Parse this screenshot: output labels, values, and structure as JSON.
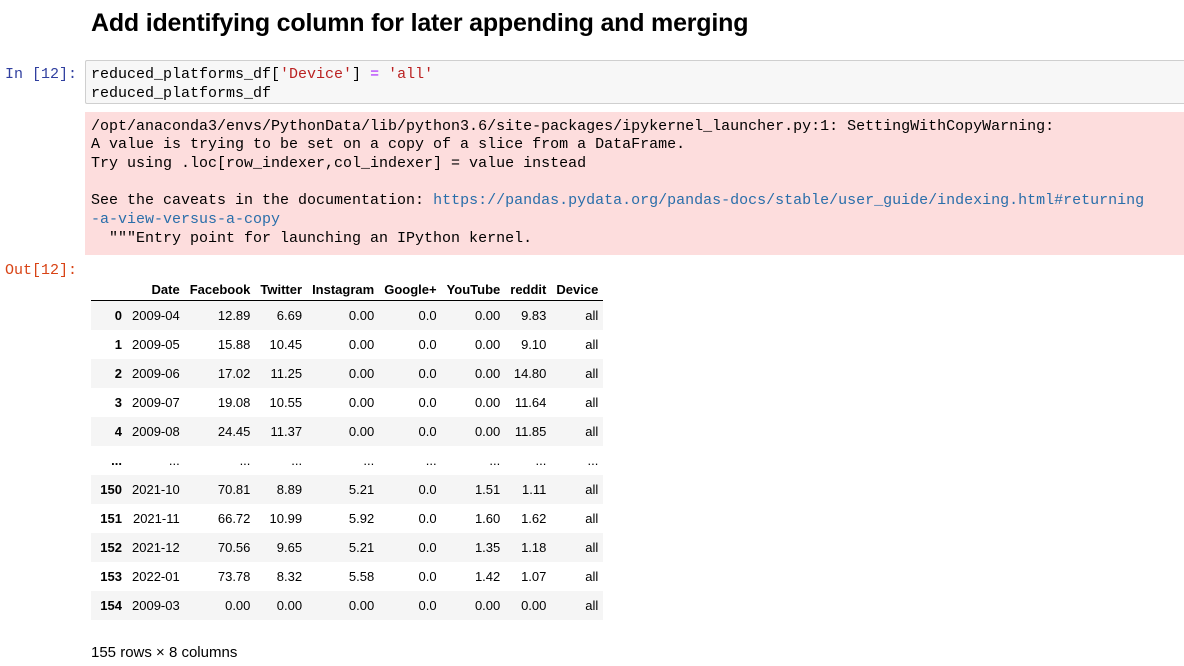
{
  "cell": {
    "heading": "Add identifying column for later appending and merging",
    "in_prompt": "In [12]:",
    "out_prompt": "Out[12]:",
    "code": {
      "line1_var": "reduced_platforms_df[",
      "line1_key": "'Device'",
      "line1_close": "] ",
      "line1_op": "=",
      "line1_space": " ",
      "line1_value": "'all'",
      "line2": "reduced_platforms_df"
    },
    "stderr": {
      "line1": "/opt/anaconda3/envs/PythonData/lib/python3.6/site-packages/ipykernel_launcher.py:1: SettingWithCopyWarning:",
      "line2": "A value is trying to be set on a copy of a slice from a DataFrame.",
      "line3": "Try using .loc[row_indexer,col_indexer] = value instead",
      "line4_prefix": "See the caveats in the documentation: ",
      "link_part1": "https://pandas.pydata.org/pandas-docs/stable/user_guide/indexing.html#returning",
      "link_part2": "-a-view-versus-a-copy",
      "line6": "  \"\"\"Entry point for launching an IPython kernel."
    }
  },
  "table": {
    "columns": [
      "",
      "Date",
      "Facebook",
      "Twitter",
      "Instagram",
      "Google+",
      "YouTube",
      "reddit",
      "Device"
    ],
    "rows": [
      [
        "0",
        "2009-04",
        "12.89",
        "6.69",
        "0.00",
        "0.0",
        "0.00",
        "9.83",
        "all"
      ],
      [
        "1",
        "2009-05",
        "15.88",
        "10.45",
        "0.00",
        "0.0",
        "0.00",
        "9.10",
        "all"
      ],
      [
        "2",
        "2009-06",
        "17.02",
        "11.25",
        "0.00",
        "0.0",
        "0.00",
        "14.80",
        "all"
      ],
      [
        "3",
        "2009-07",
        "19.08",
        "10.55",
        "0.00",
        "0.0",
        "0.00",
        "11.64",
        "all"
      ],
      [
        "4",
        "2009-08",
        "24.45",
        "11.37",
        "0.00",
        "0.0",
        "0.00",
        "11.85",
        "all"
      ],
      [
        "...",
        "...",
        "...",
        "...",
        "...",
        "...",
        "...",
        "...",
        "..."
      ],
      [
        "150",
        "2021-10",
        "70.81",
        "8.89",
        "5.21",
        "0.0",
        "1.51",
        "1.11",
        "all"
      ],
      [
        "151",
        "2021-11",
        "66.72",
        "10.99",
        "5.92",
        "0.0",
        "1.60",
        "1.62",
        "all"
      ],
      [
        "152",
        "2021-12",
        "70.56",
        "9.65",
        "5.21",
        "0.0",
        "1.35",
        "1.18",
        "all"
      ],
      [
        "153",
        "2022-01",
        "73.78",
        "8.32",
        "5.58",
        "0.0",
        "1.42",
        "1.07",
        "all"
      ],
      [
        "154",
        "2009-03",
        "0.00",
        "0.00",
        "0.00",
        "0.0",
        "0.00",
        "0.00",
        "all"
      ]
    ],
    "footer": "155 rows × 8 columns"
  },
  "colors": {
    "in_prompt": "#303F9F",
    "out_prompt": "#D84315",
    "stderr_bg": "#fddddd",
    "string_token": "#BA2121",
    "operator_token": "#AA22FF",
    "link": "#296eaa"
  }
}
